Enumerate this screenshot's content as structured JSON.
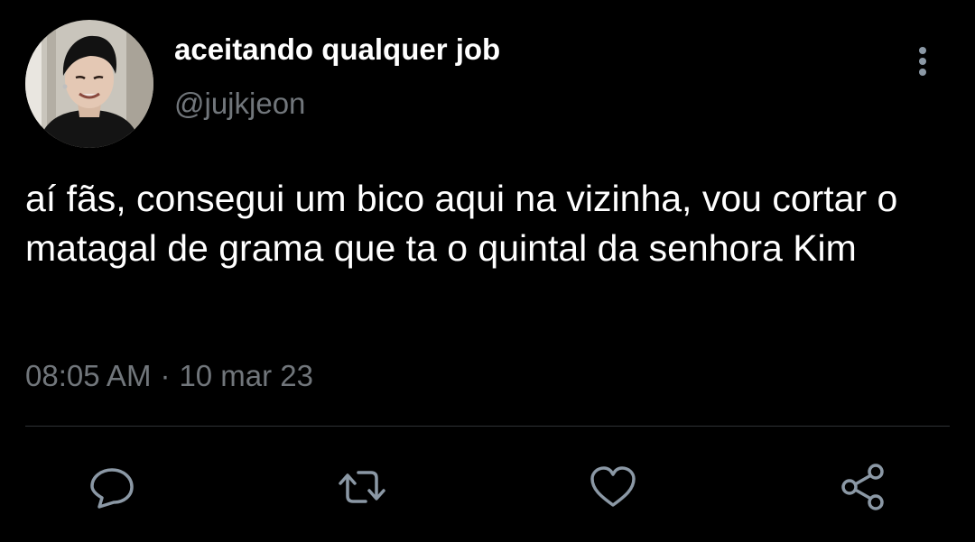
{
  "tweet": {
    "author": {
      "display_name": "aceitando qualquer job",
      "handle": "@jujkjeon",
      "avatar_icon": "user-avatar-photo"
    },
    "text": "aí fãs, consegui um bico aqui na vizinha, vou cortar o matagal de grama que ta o quintal da senhora Kim",
    "time": "08:05 AM",
    "separator": "·",
    "date": "10 mar 23"
  },
  "actions": {
    "reply_icon": "comment-icon",
    "retweet_icon": "retweet-icon",
    "like_icon": "heart-icon",
    "share_icon": "share-icon",
    "more_icon": "more-vertical-icon"
  },
  "colors": {
    "background": "#000000",
    "text_primary": "#ffffff",
    "text_secondary": "#71767b",
    "divider": "#2f3336",
    "icon": "#8b98a5"
  }
}
